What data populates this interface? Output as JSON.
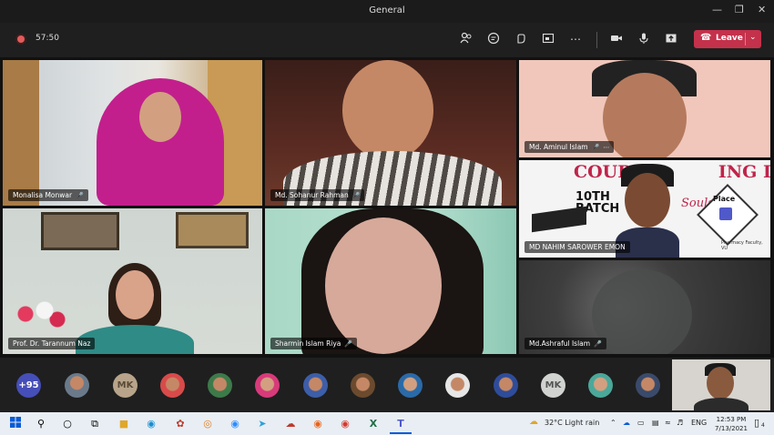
{
  "window": {
    "title": "General"
  },
  "toolbar": {
    "timer": "57:50",
    "leave_label": "Leave"
  },
  "participants": [
    {
      "name": "Monalisa Monwar"
    },
    {
      "name": "Md. Sohanur Rahman"
    },
    {
      "name": "Md. Aminul Islam"
    },
    {
      "name": "MD NAHIM SAROWER EMON"
    },
    {
      "name": "Prof. Dr. Tarannum Naz"
    },
    {
      "name": "Sharmin Islam Riya"
    },
    {
      "name": "Md.Ashraful Islam"
    }
  ],
  "banner": {
    "line1": "COURSE",
    "line1b": "ING DAY",
    "batch": "10TH BATCH",
    "souls": "Souls",
    "place": "Place",
    "faculty": "Pharmacy Faculty, VU"
  },
  "strip": {
    "overflow_count": "+95",
    "initials_1": "MK",
    "initials_2": "MK"
  },
  "taskbar": {
    "weather": "32°C  Light rain",
    "lang": "ENG",
    "time": "12:53 PM",
    "date": "7/13/2021",
    "notif_count": "4"
  },
  "colors": {
    "leave": "#c4314b",
    "recording": "#e35b5b",
    "overflow_badge": "#464eb8"
  }
}
